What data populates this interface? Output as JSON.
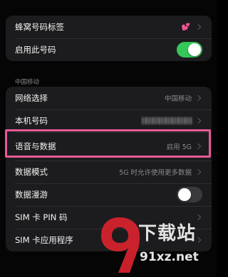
{
  "top_group": {
    "rows": [
      {
        "label": "蜂窝号码标签",
        "icon": "heart-tag-icon"
      },
      {
        "label": "启用此号码",
        "toggle": "on"
      }
    ]
  },
  "carrier_section": {
    "header": "中国移动",
    "rows": [
      {
        "label": "网络选择",
        "value": "中国移动"
      },
      {
        "label": "本机号码"
      },
      {
        "label": "语音与数据",
        "value": "启用 5G"
      },
      {
        "label": "数据模式",
        "value": "5G 时允许使用更多数据"
      },
      {
        "label": "数据漫游",
        "toggle": "off"
      },
      {
        "label": "SIM 卡 PIN 码"
      },
      {
        "label": "SIM 卡应用程序"
      }
    ]
  },
  "watermark": {
    "site_name": "下载站",
    "url": "91xz.net"
  },
  "colors": {
    "background": "#050505",
    "group": "#1c1c1e",
    "toggle_on": "#34c759",
    "highlight": "#e85a96",
    "watermark_red": "#d9232e"
  }
}
